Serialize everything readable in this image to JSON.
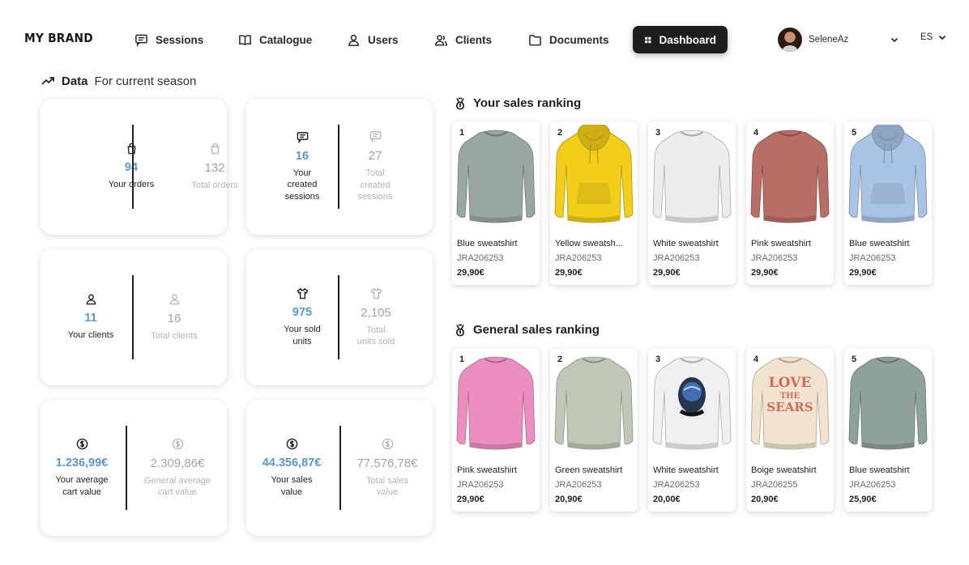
{
  "brand": "MY BRAND",
  "nav": [
    {
      "label": "Sessions",
      "icon": "sessions-icon"
    },
    {
      "label": "Catalogue",
      "icon": "book-icon"
    },
    {
      "label": "Users",
      "icon": "user-icon"
    },
    {
      "label": "Clients",
      "icon": "clients-icon"
    },
    {
      "label": "Documents",
      "icon": "folder-icon"
    },
    {
      "label": "Dashboard",
      "icon": "dashboard-icon",
      "active": true
    }
  ],
  "user": {
    "name": "SeleneAz"
  },
  "language": "ES",
  "data_section": {
    "title": "Data",
    "subtitle": "For current season"
  },
  "stats": [
    {
      "icon": "bag-icon",
      "mine_value": "94",
      "mine_label": "Your orders",
      "total_value": "132",
      "total_label": "Total orders"
    },
    {
      "icon": "sessions-icon",
      "mine_value": "16",
      "mine_label": "Your\ncreated\nsessions",
      "total_value": "27",
      "total_label": "Total\ncreated\nsessions"
    },
    {
      "icon": "user-icon",
      "mine_value": "11",
      "mine_label": "Your clients",
      "total_value": "16",
      "total_label": "Total clients"
    },
    {
      "icon": "tshirt-icon",
      "mine_value": "975",
      "mine_label": "Your sold\nunits",
      "total_value": "2,105",
      "total_label": "Total\nunits sold"
    },
    {
      "icon": "dollar-icon",
      "mine_value": "1.236,99€",
      "mine_label": "Your average\ncart value",
      "total_value": "2.309,86€",
      "total_label": "General average\ncart value"
    },
    {
      "icon": "dollar-icon",
      "mine_value": "44.356,87€",
      "mine_label": "Your sales\nvalue",
      "total_value": "77.576,78€",
      "total_label": "Total sales\nvalue"
    }
  ],
  "your_ranking": {
    "title": "Your sales ranking",
    "items": [
      {
        "position": "1",
        "name": "Blue sweatshirt",
        "code": "JRA206253",
        "price": "29,90€",
        "color": "#9aa6a3",
        "style": "crew"
      },
      {
        "position": "2",
        "name": "Yellow sweatsh...",
        "code": "JRA206253",
        "price": "29,90€",
        "color": "#f2cd1a",
        "style": "hood"
      },
      {
        "position": "3",
        "name": "White sweatshirt",
        "code": "JRA206253",
        "price": "29,90€",
        "color": "#ececec",
        "style": "crew"
      },
      {
        "position": "4",
        "name": "Pink sweatshirt",
        "code": "JRA206253",
        "price": "29,90€",
        "color": "#b86e66",
        "style": "crew"
      },
      {
        "position": "5",
        "name": "Blue sweatshirt",
        "code": "JRA206253",
        "price": "29,90€",
        "color": "#a8c3e4",
        "style": "hood"
      }
    ]
  },
  "general_ranking": {
    "title": "General sales ranking",
    "items": [
      {
        "position": "1",
        "name": "Pink sweatshirt",
        "code": "JRA206253",
        "price": "29,90€",
        "color": "#ec8ec0",
        "style": "crew"
      },
      {
        "position": "2",
        "name": "Green sweatshirt",
        "code": "JRA206253",
        "price": "20,90€",
        "color": "#bfc8b6",
        "style": "crew"
      },
      {
        "position": "3",
        "name": "White sweatshirt",
        "code": "JRA206253",
        "price": "20,00€",
        "color": "#f0f0f3",
        "style": "print"
      },
      {
        "position": "4",
        "name": "Boige sweatshirt",
        "code": "JRA206255",
        "price": "20,90€",
        "color": "#f1e3cf",
        "style": "love"
      },
      {
        "position": "5",
        "name": "Blue sweatshirt",
        "code": "JRA206253",
        "price": "25,90€",
        "color": "#8fa19c",
        "style": "crew"
      }
    ]
  },
  "print_text": {
    "love": "LOVE",
    "the": "THE",
    "sears": "SEARS"
  }
}
